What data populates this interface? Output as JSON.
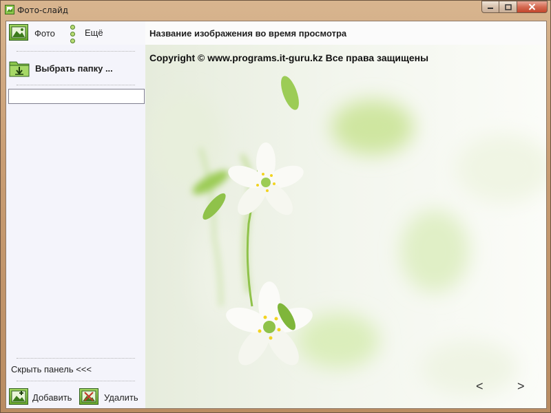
{
  "window": {
    "title": "Фото-слайд"
  },
  "toolbar": {
    "photo_label": "Фото",
    "more_label": "Ещё"
  },
  "sidebar": {
    "choose_folder_label": "Выбрать папку ...",
    "folder_value": "",
    "hide_panel_label": "Скрыть панель <<<",
    "add_label": "Добавить",
    "delete_label": "Удалить"
  },
  "viewer": {
    "image_title": "Название изображения во время просмотра",
    "copyright": "Copyright © www.programs.it-guru.kz Все права защищены",
    "prev_label": "<",
    "next_label": ">"
  },
  "icons": {
    "app": "photo-slide-app-icon",
    "photo": "picture-icon",
    "more": "vertical-dots-icon",
    "folder": "folder-download-icon",
    "add": "add-picture-icon",
    "delete": "delete-picture-icon",
    "minimize": "minimize-icon",
    "maximize": "maximize-icon",
    "close": "close-icon"
  },
  "colors": {
    "accent_green": "#6aa82e",
    "sidebar_bg": "#f4f4fb",
    "close_button": "#c3462c"
  }
}
